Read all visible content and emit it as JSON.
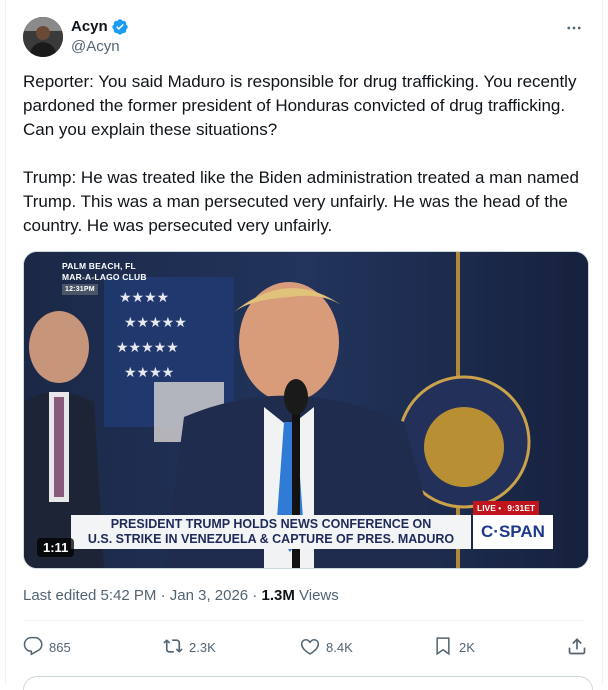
{
  "author": {
    "display_name": "Acyn",
    "handle": "@Acyn"
  },
  "tweet": {
    "text": "Reporter: You said Maduro is responsible for drug trafficking. You recently pardoned the former president of Honduras convicted of drug trafficking. Can you explain these situations?\n\nTrump: He was treated like the Biden administration treated a man named Trump. This was a man persecuted very unfairly. He was the head of the country. He was persecuted very unfairly."
  },
  "video": {
    "location_line1": "PALM BEACH, FL",
    "location_line2": "MAR-A-LAGO CLUB",
    "location_time": "12:31PM",
    "live_label": "LIVE •",
    "live_time": "9:31ET",
    "banner_line1": "PRESIDENT TRUMP HOLDS NEWS CONFERENCE ON",
    "banner_line2": "U.S. STRIKE IN VENEZUELA & CAPTURE OF PRES. MADURO",
    "network": "C·SPAN",
    "duration": "1:11"
  },
  "meta": {
    "edited_label": "Last edited 5:42 PM · Jan 3, 2026 · ",
    "views_count": "1.3M",
    "views_label": " Views"
  },
  "actions": {
    "replies": "865",
    "reposts": "2.3K",
    "likes": "8.4K",
    "bookmarks": "2K"
  },
  "icons": {
    "verified": "verified-badge-icon",
    "more": "more-dots-icon",
    "reply": "reply-icon",
    "repost": "repost-icon",
    "like": "heart-icon",
    "bookmark": "bookmark-icon",
    "share": "share-icon"
  },
  "colors": {
    "text_primary": "#0f1419",
    "text_secondary": "#536471",
    "verified_blue": "#1d9bf0",
    "border": "#eff3f4"
  }
}
